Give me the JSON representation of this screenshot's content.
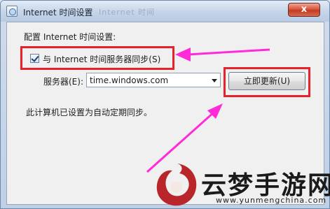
{
  "window": {
    "title": "Internet 时间设置",
    "title_ghost": "Internet 时间",
    "close_label": "x"
  },
  "settings": {
    "section_label": "配置 Internet 时间设置:",
    "sync_checkbox_label": "与 Internet 时间服务器同步(S)",
    "sync_checked": true,
    "server_label": "服务器(E):",
    "server_value": "time.windows.com",
    "update_button_label": "立即更新(U)",
    "status_text": "此计算机已设置为自动定期同步。"
  },
  "annotations": {
    "highlight_color": "#e8222a",
    "arrow_color": "#ff2bd9"
  },
  "watermark": {
    "text_cn": "云梦手游网",
    "url": "www.yunmengchina.com"
  }
}
